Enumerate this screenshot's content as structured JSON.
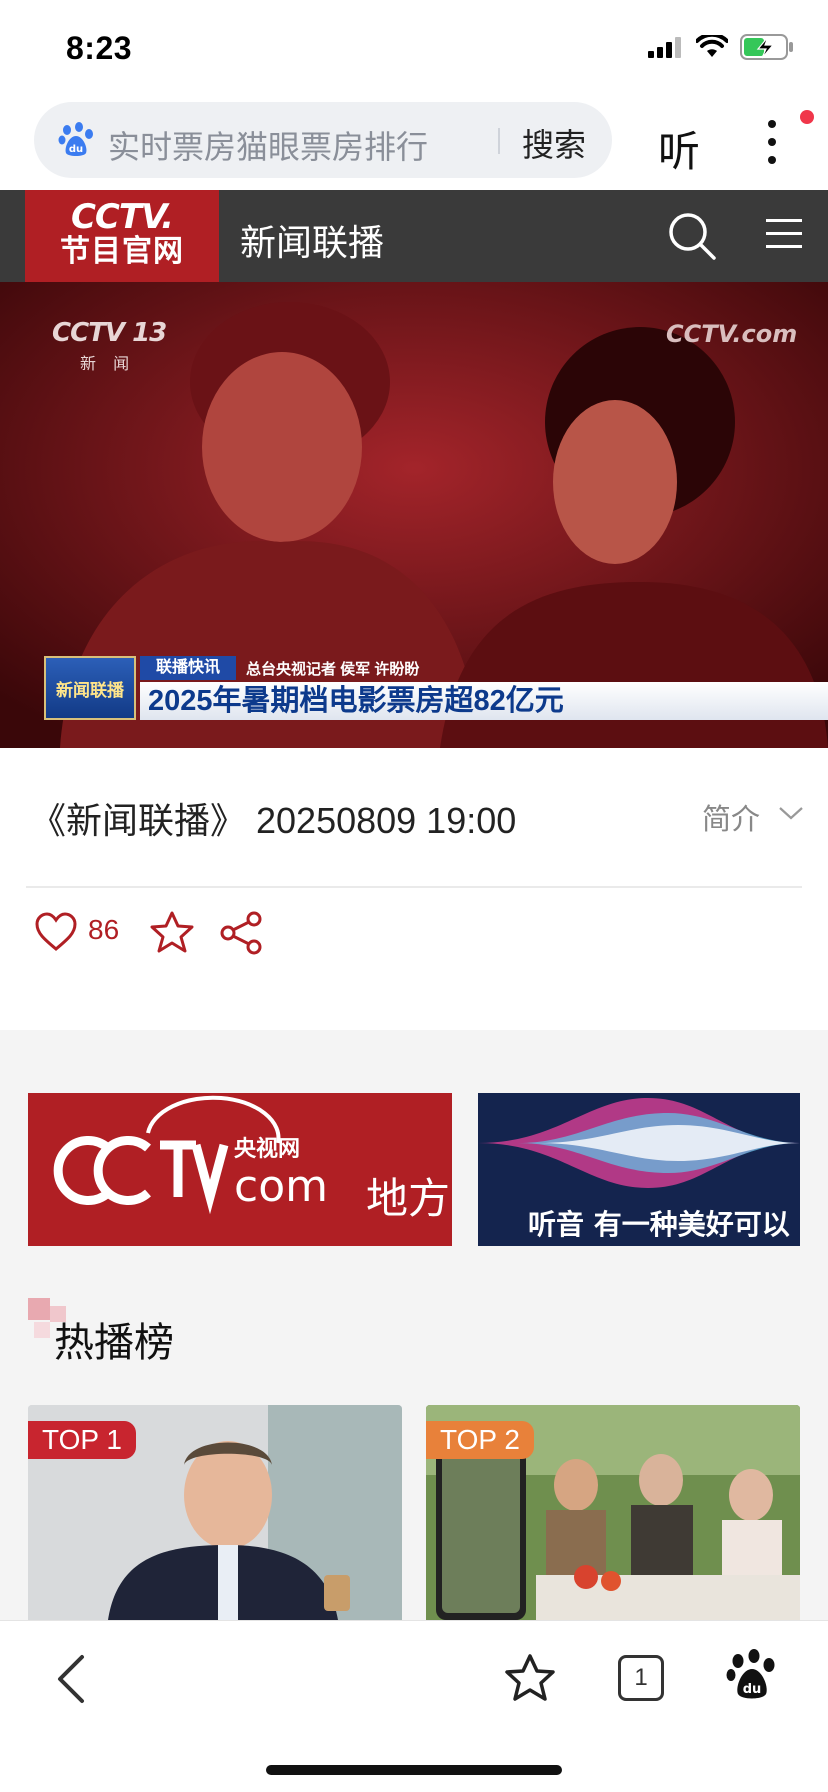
{
  "status_bar": {
    "time": "8:23"
  },
  "search": {
    "query": "实时票房猫眼票房排行",
    "button_label": "搜索",
    "listen_label": "听"
  },
  "header": {
    "logo_line1": "CCTV.",
    "logo_line2": "节目官网",
    "title": "新闻联播"
  },
  "video": {
    "watermark_left": "CCTV 13",
    "watermark_left_sub": "新 闻",
    "watermark_right": "CCTV.com",
    "ticker_logo": "新闻联播",
    "ticker_tag": "联播快讯",
    "ticker_reporter": "总台央视记者  侯军  许盼盼",
    "ticker_headline": "2025年暑期档电影票房超82亿元"
  },
  "episode": {
    "title": "《新闻联播》 20250809 19:00",
    "intro_label": "简介"
  },
  "actions": {
    "like_count": "86"
  },
  "banners": {
    "cctv_local_top": "央视网",
    "cctv_local_com": "com",
    "cctv_local_label": "地方",
    "audio_text": "听音  有一种美好可以"
  },
  "hot_list": {
    "title": "热播榜",
    "cards": [
      {
        "rank_label": "TOP 1"
      },
      {
        "rank_label": "TOP 2"
      }
    ]
  },
  "bottom_bar": {
    "tab_count": "1"
  },
  "colors": {
    "brand_red": "#b01f24",
    "header_bg": "#3a3a3a",
    "top2_orange": "#e8813a"
  }
}
